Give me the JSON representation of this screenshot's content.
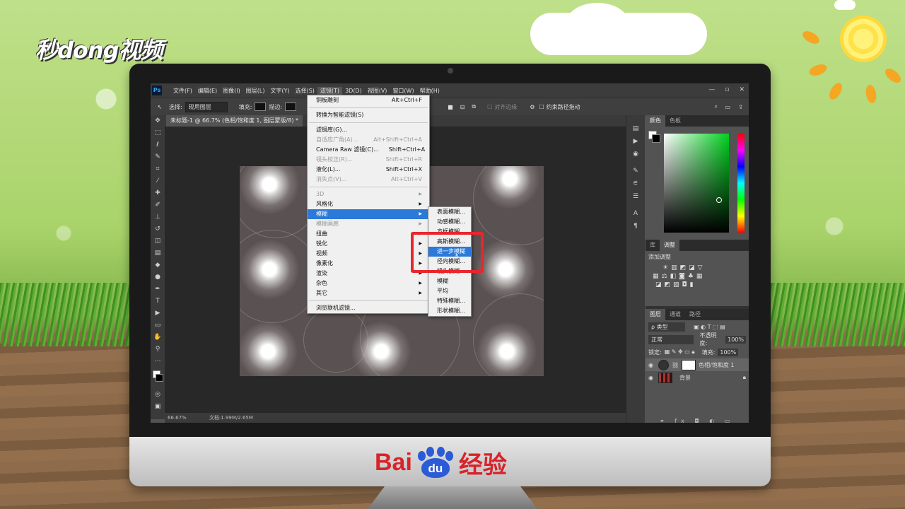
{
  "branding": {
    "logo_text": "秒dong视频",
    "baidu_prefix": "Bai",
    "baidu_paw": "du",
    "baidu_suffix": "经验"
  },
  "ps": {
    "app_icon": "Ps",
    "menubar": [
      "文件(F)",
      "编辑(E)",
      "图像(I)",
      "图层(L)",
      "文字(Y)",
      "选择(S)",
      "滤镜(T)",
      "3D(D)",
      "视图(V)",
      "窗口(W)",
      "帮助(H)"
    ],
    "window_controls": [
      "—",
      "▫",
      "✕"
    ],
    "options": {
      "select_label": "选择:",
      "select_value": "现用图层",
      "fill_label": "填充:",
      "stroke_label": "描边:",
      "align_edges": "对齐边缘",
      "constrain_path": "约束路径拖动"
    },
    "doc_tab": "未标题-1 @ 66.7% (色相/饱和度 1, 图层蒙版/8) *",
    "status": {
      "zoom": "66.67%",
      "doc_info": "文档:1.99M/2.65M"
    },
    "panels": {
      "color_tabs": [
        "颜色",
        "色板"
      ],
      "adj_tabs": [
        "库",
        "调整"
      ],
      "adj_title": "添加调整",
      "layers_tabs": [
        "图层",
        "通道",
        "路径"
      ],
      "kind": "ρ 类型",
      "blend": "正常",
      "opacity_label": "不透明度:",
      "opacity_value": "100%",
      "lock_label": "锁定:",
      "fill_label": "填充:",
      "fill_value": "100%",
      "layers": [
        {
          "name": "色相/饱和度 1"
        },
        {
          "name": "背景"
        }
      ]
    },
    "filter_menu": {
      "items": [
        {
          "label": "铜板雕刻",
          "shortcut": "Alt+Ctrl+F"
        },
        {
          "label": "转换为智能滤镜(S)",
          "shortcut": ""
        },
        {
          "label": "滤镜库(G)...",
          "shortcut": ""
        },
        {
          "label": "自适应广角(A)...",
          "shortcut": "Alt+Shift+Ctrl+A"
        },
        {
          "label": "Camera Raw 滤镜(C)...",
          "shortcut": "Shift+Ctrl+A"
        },
        {
          "label": "镜头校正(R)...",
          "shortcut": "Shift+Ctrl+R"
        },
        {
          "label": "液化(L)...",
          "shortcut": "Shift+Ctrl+X"
        },
        {
          "label": "消失点(V)...",
          "shortcut": "Alt+Ctrl+V"
        },
        {
          "label": "3D"
        },
        {
          "label": "风格化"
        },
        {
          "label": "模糊"
        },
        {
          "label": "模糊画廊"
        },
        {
          "label": "扭曲"
        },
        {
          "label": "锐化"
        },
        {
          "label": "视频"
        },
        {
          "label": "像素化"
        },
        {
          "label": "渲染"
        },
        {
          "label": "杂色"
        },
        {
          "label": "其它"
        },
        {
          "label": "浏览联机滤镜..."
        }
      ]
    },
    "blur_submenu": {
      "items": [
        "表面模糊...",
        "动感模糊...",
        "方框模糊...",
        "高斯模糊...",
        "进一步模糊",
        "径向模糊...",
        "镜头模糊...",
        "模糊",
        "平均",
        "特殊模糊...",
        "形状模糊..."
      ]
    }
  }
}
